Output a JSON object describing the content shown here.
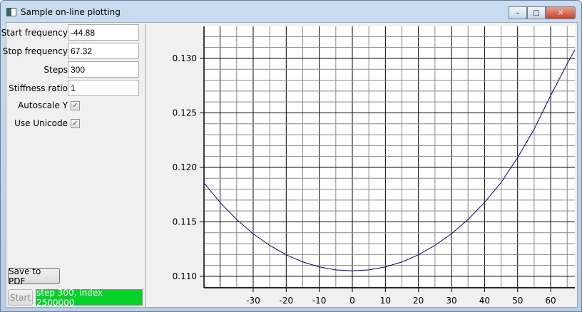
{
  "window": {
    "title": "Sample on-line plotting",
    "minimize": "–",
    "maximize": "□",
    "close": "✕"
  },
  "form": {
    "start_frequency": {
      "label": "Start frequency",
      "value": "-44.88"
    },
    "stop_frequency": {
      "label": "Stop frequency",
      "value": "67.32"
    },
    "steps": {
      "label": "Steps",
      "value": "300"
    },
    "stiffness_ratio": {
      "label": "Stiffness ratio",
      "value": "1"
    },
    "autoscale_y": {
      "label": "Autoscale Y",
      "checked": true
    },
    "use_unicode": {
      "label": "Use Unicode",
      "checked": true
    }
  },
  "buttons": {
    "save_pdf": "Save to PDF",
    "start": "Start"
  },
  "progress": {
    "text": "step 300, index 2500000",
    "value": 100,
    "color": "#06d32a"
  },
  "chart_data": {
    "type": "line",
    "xlim": [
      -44.88,
      67.32
    ],
    "ylim": [
      0.10895,
      0.13294
    ],
    "x_ticks": [
      -30,
      -20,
      -10,
      0,
      10,
      20,
      30,
      40,
      50,
      60
    ],
    "x_tick_labels": [
      "-30",
      "-20",
      "-10",
      "0",
      "10",
      "20",
      "30",
      "40",
      "50",
      "60"
    ],
    "y_ticks": [
      0.11,
      0.115,
      0.12,
      0.125,
      0.13
    ],
    "y_tick_labels": [
      "0.110",
      "0.115",
      "0.120",
      "0.125",
      "0.130"
    ],
    "grid": true,
    "line_color": "#000080",
    "series": [
      {
        "x": [
          -44.88,
          -40,
          -35,
          -30,
          -25,
          -20,
          -15,
          -10,
          -5,
          0,
          5,
          10,
          15,
          20,
          25,
          30,
          35,
          40,
          45,
          50,
          55,
          60,
          65,
          67.32
        ],
        "y": [
          0.11856,
          0.11678,
          0.11522,
          0.11391,
          0.11284,
          0.11198,
          0.11132,
          0.11086,
          0.11059,
          0.1105,
          0.11059,
          0.11086,
          0.11132,
          0.11198,
          0.11284,
          0.11391,
          0.11522,
          0.11678,
          0.11861,
          0.1209,
          0.1235,
          0.1266,
          0.1295,
          0.13079
        ]
      }
    ]
  }
}
